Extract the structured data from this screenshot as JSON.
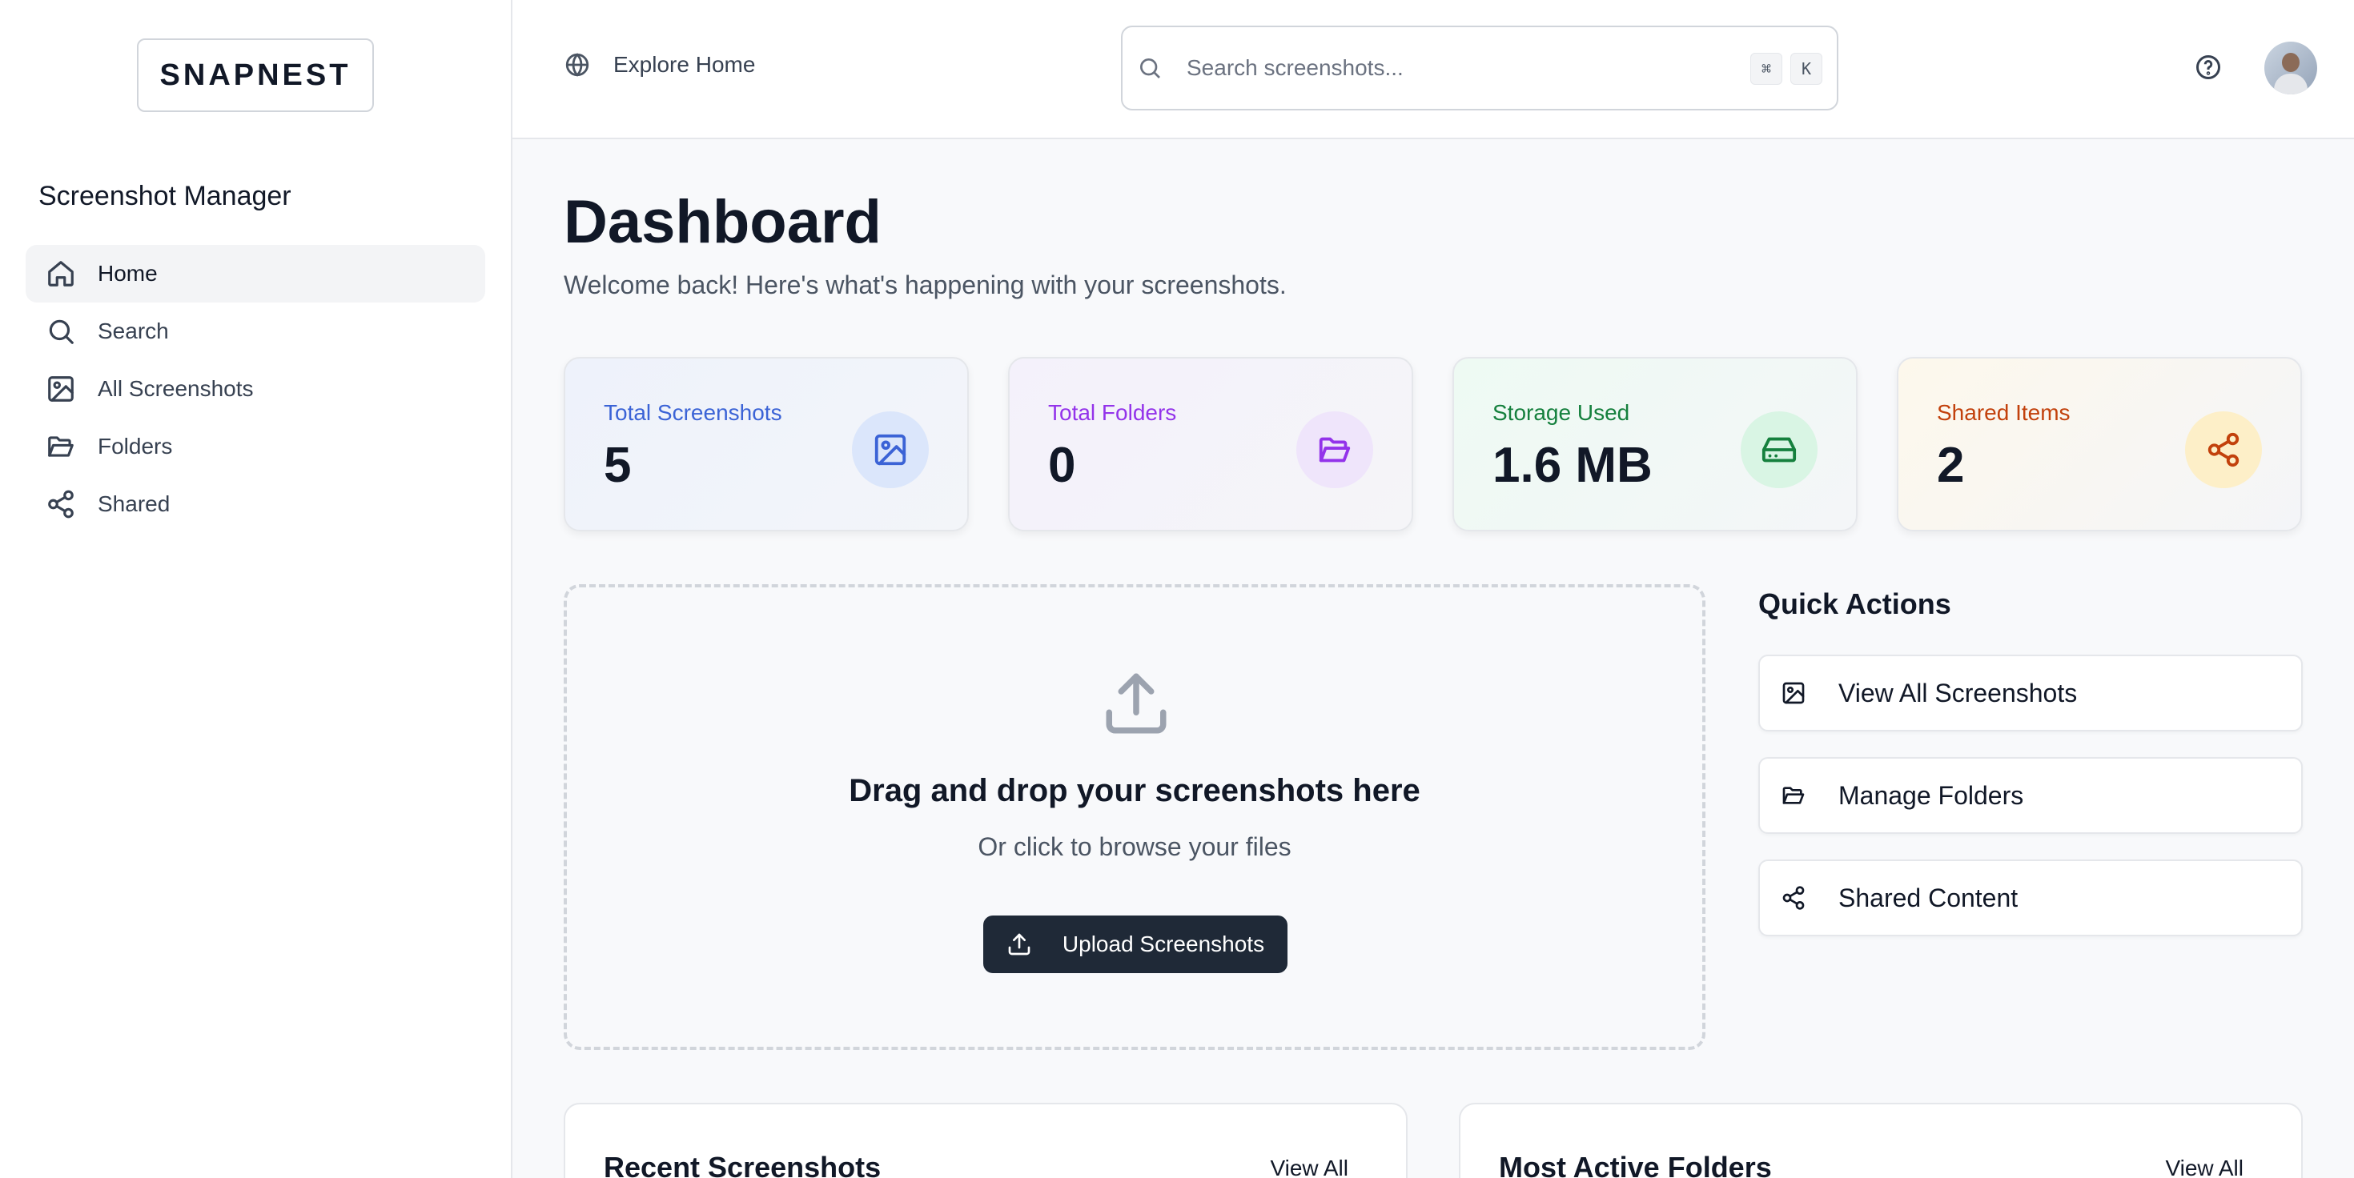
{
  "app": {
    "logo": "SNAPNEST",
    "name": "Screenshot Manager"
  },
  "sidebar": {
    "items": [
      {
        "label": "Home",
        "icon": "home-icon",
        "active": true
      },
      {
        "label": "Search",
        "icon": "search-icon",
        "active": false
      },
      {
        "label": "All Screenshots",
        "icon": "image-icon",
        "active": false
      },
      {
        "label": "Folders",
        "icon": "folder-open-icon",
        "active": false
      },
      {
        "label": "Shared",
        "icon": "share-icon",
        "active": false
      }
    ]
  },
  "header": {
    "explore_label": "Explore Home",
    "search_placeholder": "Search screenshots...",
    "shortcut_keys": [
      "⌘",
      "K"
    ]
  },
  "page": {
    "title": "Dashboard",
    "subtitle": "Welcome back! Here's what's happening with your screenshots."
  },
  "stats": [
    {
      "label": "Total Screenshots",
      "value": "5",
      "icon": "image-icon",
      "color": "#3b63d6"
    },
    {
      "label": "Total Folders",
      "value": "0",
      "icon": "folder-open-icon",
      "color": "#9333ea"
    },
    {
      "label": "Storage Used",
      "value": "1.6 MB",
      "icon": "hard-drive-icon",
      "color": "#15803d"
    },
    {
      "label": "Shared Items",
      "value": "2",
      "icon": "share-icon",
      "color": "#c2410c"
    }
  ],
  "upload": {
    "title": "Drag and drop your screenshots here",
    "subtitle": "Or click to browse your files",
    "button_label": "Upload Screenshots"
  },
  "quick_actions": {
    "title": "Quick Actions",
    "items": [
      {
        "label": "View All Screenshots",
        "icon": "image-icon"
      },
      {
        "label": "Manage Folders",
        "icon": "folder-open-icon"
      },
      {
        "label": "Shared Content",
        "icon": "share-icon"
      }
    ]
  },
  "panels": [
    {
      "title": "Recent Screenshots",
      "link": "View All"
    },
    {
      "title": "Most Active Folders",
      "link": "View All"
    }
  ]
}
